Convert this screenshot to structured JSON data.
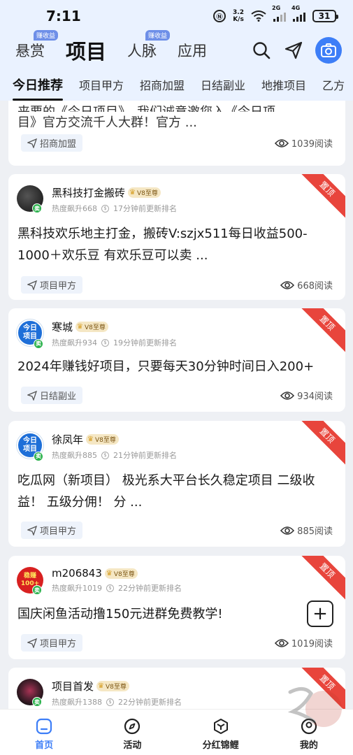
{
  "status_bar": {
    "time": "7:11",
    "speed": "3.2\nK/s",
    "signal_label": "2G",
    "signal_label2": "4G",
    "battery": "31"
  },
  "top_nav": {
    "tabs": [
      {
        "label": "悬赏",
        "badge": "赚收益"
      },
      {
        "label": "项目",
        "badge": ""
      },
      {
        "label": "人脉",
        "badge": "赚收益"
      },
      {
        "label": "应用",
        "badge": ""
      }
    ],
    "active_index": 1
  },
  "sub_nav": {
    "items": [
      "今日推荐",
      "项目甲方",
      "招商加盟",
      "日结副业",
      "地推项目",
      "乙方"
    ],
    "active_index": 0
  },
  "cards": [
    {
      "partial_title": "目》官方交流千人大群！官方 ...",
      "tag": "招商加盟",
      "views": "1039阅读"
    },
    {
      "author": "黑科技打金搬砖",
      "vip": "V8至尊",
      "pinned": "置顶",
      "heat": "热度飙升668",
      "time": "17分钟前更新排名",
      "title": "黑科技欢乐地主打金，搬砖V:szjx511每日收益500-1000＋欢乐豆 有欢乐豆可以卖 ...",
      "tag": "项目甲方",
      "views": "668阅读",
      "avatar_text": "",
      "avatar_sub": "卖"
    },
    {
      "author": "寒城",
      "vip": "V8至尊",
      "pinned": "置顶",
      "heat": "热度飙升934",
      "time": "19分钟前更新排名",
      "title": "2024年赚钱好项目，只要每天30分钟时间日入200+",
      "tag": "日结副业",
      "views": "934阅读",
      "avatar_text": "今日\n项目",
      "avatar_sub": "卖"
    },
    {
      "author": "徐凤年",
      "vip": "V8至尊",
      "pinned": "置顶",
      "heat": "热度飙升885",
      "time": "21分钟前更新排名",
      "title": "吃瓜网（新项目） 极光系大平台长久稳定项目 二级收益！ 五级分佣！ 分 ...",
      "tag": "项目甲方",
      "views": "885阅读",
      "avatar_text": "今日\n项目",
      "avatar_sub": "卖"
    },
    {
      "author": "m206843",
      "vip": "V8至尊",
      "pinned": "置顶",
      "heat": "热度飙升1019",
      "time": "22分钟前更新排名",
      "title": "国庆闲鱼活动撸150元进群免费教学!",
      "tag": "项目甲方",
      "views": "1019阅读",
      "avatar_text": "稳赚\n100+",
      "avatar_sub": "卖"
    },
    {
      "author": "项目首发",
      "vip": "V8至尊",
      "pinned": "置顶",
      "heat": "热度飙升1388",
      "time": "22分钟前更新排名",
      "avatar_text": "",
      "avatar_sub": "卖"
    }
  ],
  "bottom_nav": {
    "items": [
      "首页",
      "活动",
      "分红锦鲤",
      "我的"
    ],
    "active_index": 0
  },
  "colors": {
    "accent": "#3d7ef7",
    "pinned": "#e8453c",
    "vip_bg": "#f5e7c4"
  }
}
